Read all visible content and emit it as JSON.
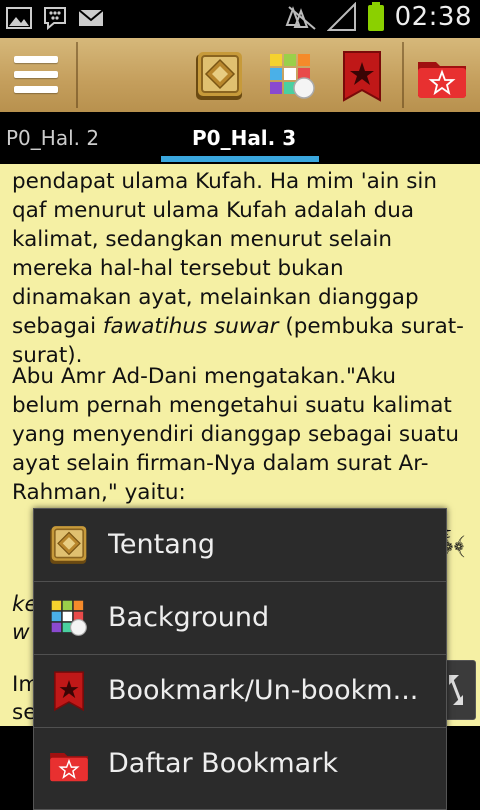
{
  "status_bar": {
    "time": "02:38",
    "icons": [
      "image-icon",
      "bbm-icon",
      "mail-icon",
      "network-icon",
      "signal-icon",
      "battery-icon"
    ],
    "battery_color": "#8bd000"
  },
  "action_bar": {
    "background_color": "#c8a464",
    "buttons": [
      "menu-icon",
      "quran-book-icon",
      "background-palette-icon",
      "bookmark-star-icon",
      "bookmark-folder-icon"
    ]
  },
  "tabs": [
    {
      "label": "P0_Hal. 2",
      "active": false
    },
    {
      "label": "P0_Hal. 3",
      "active": true
    }
  ],
  "tab_indicator_color": "#3aa7de",
  "content": {
    "background_color": "#f5f0a4",
    "paragraph1_text": "pendapat ulama Kufah. Ha mim 'ain sin qaf menurut ulama Kufah adalah dua kalimat, sedangkan menurut selain mereka hal-hal tersebut bukan dinamakan ayat, melainkan dianggap sebagai ",
    "paragraph1_italic": "fawatihus suwar",
    "paragraph1_end": " (pembuka surat-surat).",
    "paragraph2": "Abu Amr Ad-Dani mengatakan.\"Aku belum pernah mengetahui suatu kalimat yang menyendiri dianggap sebagai suatu ayat selain firman-Nya dalam surat Ar-Rahman,\" yaitu:",
    "arabic_fragment": "﴿ۚ﴾",
    "frag_ke": "ke",
    "frag_w": "w",
    "frag_im": "Im",
    "frag_se": "se"
  },
  "popup_menu": {
    "items": [
      {
        "label": "Tentang",
        "icon": "quran-book-icon"
      },
      {
        "label": "Background",
        "icon": "background-palette-icon"
      },
      {
        "label": "Bookmark/Un-bookm...",
        "icon": "bookmark-star-icon"
      },
      {
        "label": "Daftar Bookmark",
        "icon": "bookmark-folder-icon"
      }
    ]
  }
}
